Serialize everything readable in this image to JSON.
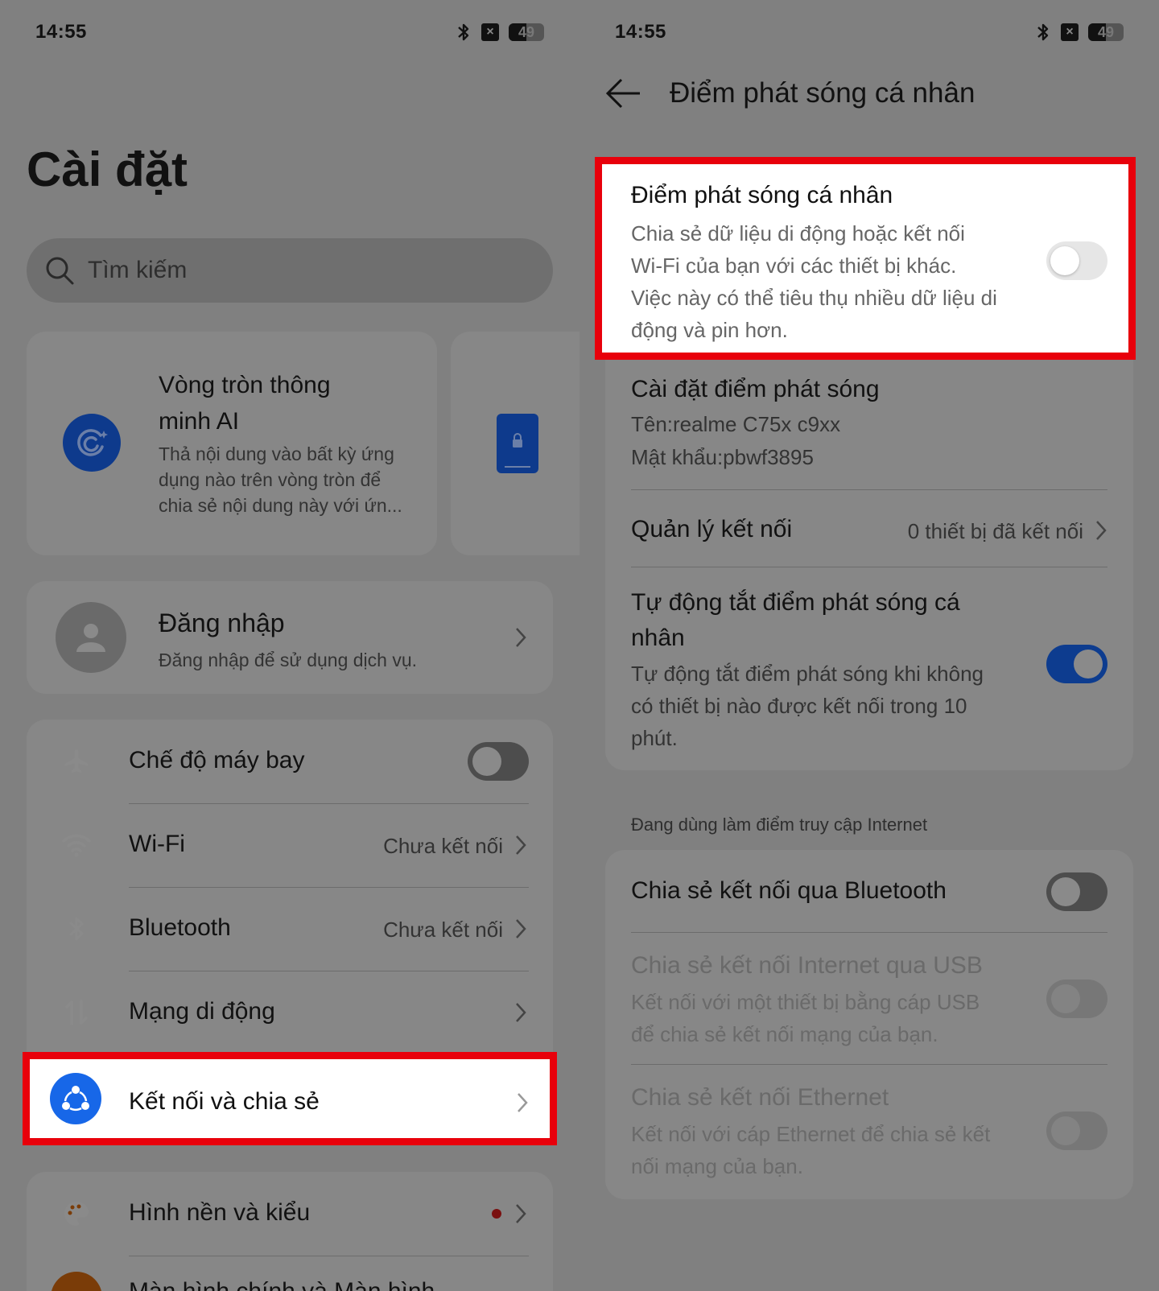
{
  "status_bar": {
    "time": "14:55",
    "battery": "49",
    "battery_level": 0.5
  },
  "left": {
    "title": "Cài đặt",
    "search": {
      "placeholder": "Tìm kiếm"
    },
    "ai_card": {
      "title_line1": "Vòng tròn thông",
      "title_line2": "minh AI",
      "desc_line1": "Thả nội dung vào bất kỳ ứng",
      "desc_line2": "dụng nào trên vòng tròn để",
      "desc_line3": "chia sẻ nội dung này với ứn..."
    },
    "login": {
      "title": "Đăng nhập",
      "subtitle": "Đăng nhập để sử dụng dịch vụ."
    },
    "items": [
      {
        "label": "Chế độ máy bay",
        "toggle": "off"
      },
      {
        "label": "Wi-Fi",
        "value": "Chưa kết nối"
      },
      {
        "label": "Bluetooth",
        "value": "Chưa kết nối"
      },
      {
        "label": "Mạng di động"
      },
      {
        "label": "Kết nối và chia sẻ"
      },
      {
        "label": "Hình nền và kiểu"
      },
      {
        "label": "Màn hình chính và Màn hình"
      }
    ],
    "colors": {
      "airplane": "#7a5c0a",
      "wifi": "#0c2f78",
      "bluetooth": "#0c2f78",
      "mobile": "#0f4d1c",
      "share": "#1767e8",
      "wallpaper": "#7a3c08",
      "highlight": "#e8000b"
    }
  },
  "right": {
    "header_title": "Điểm phát sóng cá nhân",
    "hotspot": {
      "title": "Điểm phát sóng cá nhân",
      "desc_line1": "Chia sẻ dữ liệu di động hoặc kết nối",
      "desc_line2": "Wi-Fi của bạn với các thiết bị khác.",
      "desc_line3": "Việc này có thể tiêu thụ nhiều dữ liệu di",
      "desc_line4": "động và pin hơn.",
      "enabled": false
    },
    "settings": {
      "title": "Cài đặt điểm phát sóng",
      "name": "Tên:realme C75x c9xx",
      "password": "Mật khẩu:pbwf3895"
    },
    "manage": {
      "title": "Quản lý kết nối",
      "value": "0 thiết bị đã kết nối"
    },
    "auto_off": {
      "title_line1": "Tự động tắt điểm phát sóng cá",
      "title_line2": "nhân",
      "desc_line1": "Tự động tắt điểm phát sóng khi không",
      "desc_line2": "có thiết bị nào được kết nối trong 10",
      "desc_line3": "phút.",
      "enabled": true
    },
    "section_label": "Đang dùng làm điểm truy cập Internet",
    "bt_tether": {
      "title": "Chia sẻ kết nối qua Bluetooth",
      "enabled": false
    },
    "usb_tether": {
      "title": "Chia sẻ kết nối Internet qua USB",
      "desc_line1": "Kết nối với một thiết bị bằng cáp USB",
      "desc_line2": "để chia sẻ kết nối mạng của bạn."
    },
    "eth_tether": {
      "title": "Chia sẻ kết nối Ethernet",
      "desc_line1": "Kết nối với cáp Ethernet để chia sẻ kết",
      "desc_line2": "nối mạng của bạn."
    }
  }
}
